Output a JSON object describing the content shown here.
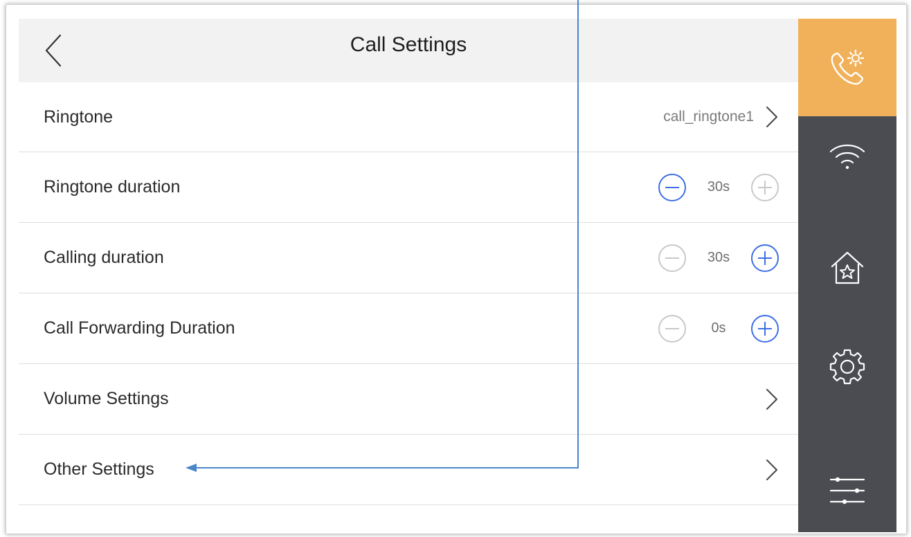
{
  "header": {
    "title": "Call Settings",
    "back_icon": "chevron-left-icon"
  },
  "rows": [
    {
      "label": "Ringtone",
      "type": "link",
      "value": "call_ringtone1"
    },
    {
      "label": "Ringtone duration",
      "type": "stepper",
      "value": "30s",
      "minus_enabled": true,
      "plus_enabled": false
    },
    {
      "label": "Calling duration",
      "type": "stepper",
      "value": "30s",
      "minus_enabled": false,
      "plus_enabled": true
    },
    {
      "label": "Call Forwarding Duration",
      "type": "stepper",
      "value": "0s",
      "minus_enabled": false,
      "plus_enabled": true
    },
    {
      "label": "Volume Settings",
      "type": "link"
    },
    {
      "label": "Other Settings",
      "type": "link"
    }
  ],
  "sidebar": {
    "items": [
      {
        "icon": "call-settings-icon",
        "active": true
      },
      {
        "icon": "wifi-icon",
        "active": false
      },
      {
        "icon": "home-star-icon",
        "active": false
      },
      {
        "icon": "gear-icon",
        "active": false
      },
      {
        "icon": "sliders-icon",
        "active": false
      }
    ]
  },
  "colors": {
    "accent_active": "#f0b15a",
    "sidebar_bg": "#4b4b52",
    "stepper_enabled": "#3d6ee6",
    "stepper_disabled": "#c8c8c8",
    "annotation": "#4a86c8"
  }
}
